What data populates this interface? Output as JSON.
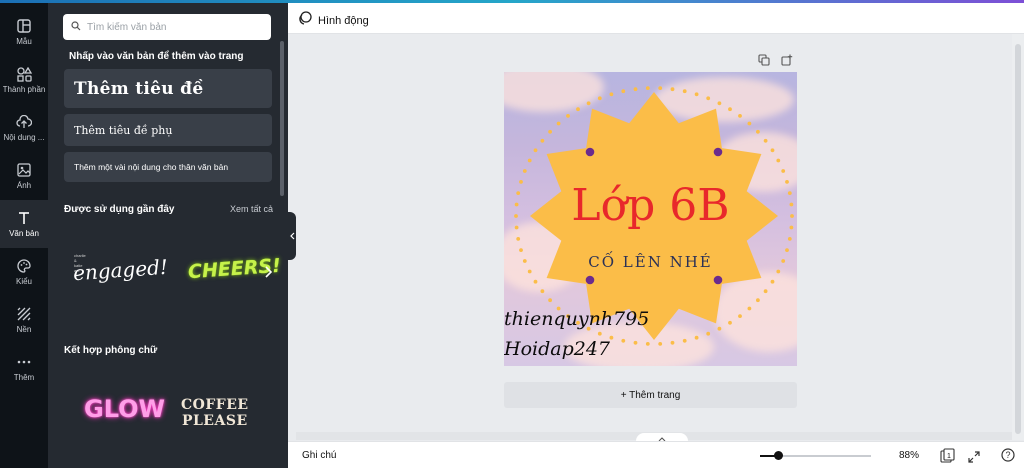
{
  "sidebar": {
    "items": [
      {
        "label": "Mẫu",
        "icon": "layout-icon"
      },
      {
        "label": "Thành phần",
        "icon": "shapes-icon"
      },
      {
        "label": "Nội dung ...",
        "icon": "cloud-upload-icon"
      },
      {
        "label": "Ảnh",
        "icon": "image-icon"
      },
      {
        "label": "Văn bản",
        "icon": "text-icon",
        "active": true
      },
      {
        "label": "Kiểu",
        "icon": "palette-icon"
      },
      {
        "label": "Nền",
        "icon": "pattern-icon"
      },
      {
        "label": "Thêm",
        "icon": "more-dots-icon"
      }
    ]
  },
  "panel": {
    "search_placeholder": "Tìm kiếm văn bản",
    "heading": "Nhấp vào văn bản để thêm vào trang",
    "add_heading": "Thêm tiêu đề",
    "add_subheading": "Thêm tiêu đề phụ",
    "add_body": "Thêm một vài nội dung cho thân văn bản",
    "recent_title": "Được sử dụng gần đây",
    "see_all": "Xem tất cả",
    "recent_items": [
      {
        "small": "charlie & katie are",
        "text": "engaged!"
      },
      {
        "text": "CHEERS!"
      }
    ],
    "combo_title": "Kết hợp phông chữ",
    "combo_items": [
      {
        "text": "GLOW"
      },
      {
        "line1": "COFFEE",
        "line2": "PLEASE"
      }
    ]
  },
  "topbar": {
    "animate_label": "Hình động"
  },
  "design": {
    "title": "Lớp 6B",
    "subtitle": "CỐ LÊN NHÉ",
    "signature1": "thienquynh795",
    "signature2": "Hoidap247",
    "colors": {
      "badge": "#fbbd48",
      "dots": "#6b2b8d",
      "title": "#e8282b",
      "subtitle": "#2a3156"
    }
  },
  "canvas": {
    "add_page": "+ Thêm trang"
  },
  "bottombar": {
    "notes": "Ghi chú",
    "zoom": "88%",
    "zoom_fraction": 0.16,
    "page_count": "1"
  }
}
